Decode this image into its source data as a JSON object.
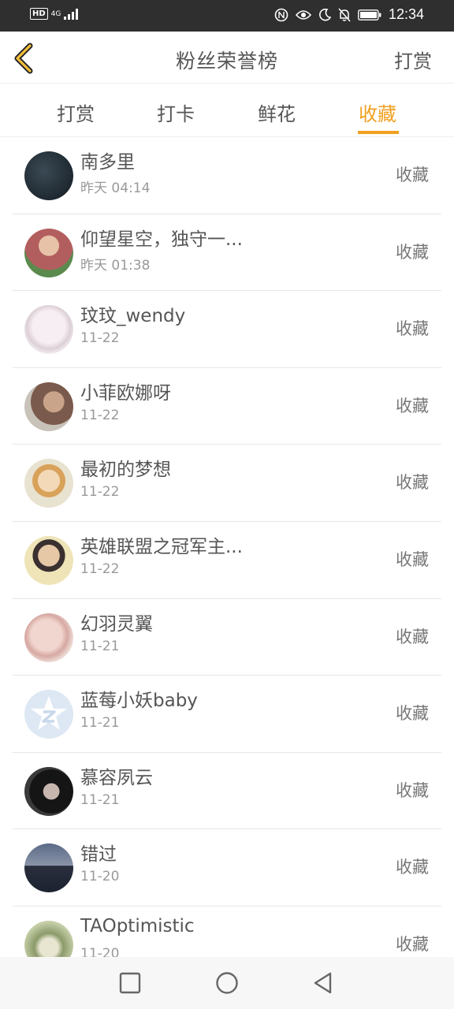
{
  "status_bar": {
    "hd": "HD",
    "network": "4G",
    "time": "12:34",
    "icons": [
      "signal-icon",
      "nfc-icon",
      "eye-icon",
      "moon-icon",
      "bell-off-icon",
      "battery-icon"
    ]
  },
  "header": {
    "title": "粉丝荣誉榜",
    "right_action": "打赏"
  },
  "tabs": [
    {
      "label": "打赏"
    },
    {
      "label": "打卡"
    },
    {
      "label": "鲜花"
    },
    {
      "label": "收藏"
    }
  ],
  "active_tab": "收藏",
  "accent_color": "#f0a020",
  "rows": [
    {
      "name": "南多里",
      "time": "昨天 04:14",
      "action": "收藏",
      "avatar_color": "#1f2a33"
    },
    {
      "name": "仰望星空，独守一...",
      "time": "昨天 01:38",
      "action": "收藏",
      "avatar_color": "#b97a6e"
    },
    {
      "name": "玟玟_wendy",
      "time": "11-22",
      "action": "收藏",
      "avatar_color": "#efe8ec"
    },
    {
      "name": "小菲欧娜呀",
      "time": "11-22",
      "action": "收藏",
      "avatar_color": "#a88a7c"
    },
    {
      "name": "最初的梦想",
      "time": "11-22",
      "action": "收藏",
      "avatar_color": "#e9d7b0"
    },
    {
      "name": "英雄联盟之冠军主...",
      "time": "11-22",
      "action": "收藏",
      "avatar_color": "#d8c9a0"
    },
    {
      "name": "幻羽灵翼",
      "time": "11-21",
      "action": "收藏",
      "avatar_color": "#e4c3bd"
    },
    {
      "name": "蓝莓小妖baby",
      "time": "11-21",
      "action": "收藏",
      "avatar_color": "#dde8f4"
    },
    {
      "name": "慕容夙云",
      "time": "11-21",
      "action": "收藏",
      "avatar_color": "#2b2b2b"
    },
    {
      "name": "错过",
      "time": "11-20",
      "action": "收藏",
      "avatar_color": "#3d4456"
    },
    {
      "name": "TAOptimistic",
      "time": "11-20",
      "action": "收藏",
      "avatar_color": "#a7b48a"
    }
  ],
  "nav": {
    "icons": [
      "square-recent-icon",
      "circle-home-icon",
      "triangle-back-icon"
    ]
  }
}
